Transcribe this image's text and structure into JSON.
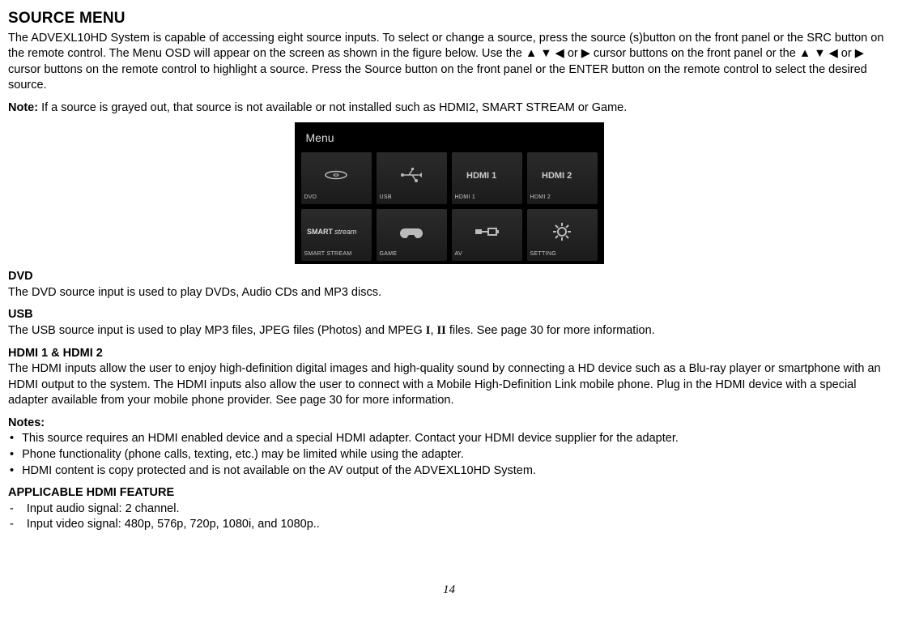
{
  "title": "SOURCE MENU",
  "intro_parts": {
    "a": "The ADVEXL10HD System is capable of accessing eight source inputs.  To select or change a source, press the source (s)button on the front panel or the SRC button on the remote control. The Menu OSD will appear on the screen as shown in the figure below.  Use the ",
    "b": " cursor buttons on the front panel or the ",
    "c": " cursor buttons on the remote control to highlight a source. Press the Source button on the front panel or the ENTER button on the remote control to select the desired source."
  },
  "arrows_seq": "▲ ▼ ◀ or ▶",
  "note_label": "Note:",
  "note_text": " If a source is grayed out, that source is not available or not installed such as HDMI2, SMART STREAM or Game.",
  "osd": {
    "menu_title": "Menu",
    "cells": [
      {
        "label": "DVD"
      },
      {
        "label": "USB"
      },
      {
        "label": "HDMI 1"
      },
      {
        "label": "HDMI 2"
      },
      {
        "label": "SMART STREAM"
      },
      {
        "label": "GAME"
      },
      {
        "label": "AV"
      },
      {
        "label": "SETTING"
      }
    ]
  },
  "sections": {
    "dvd": {
      "heading": "DVD",
      "body": "The DVD source input is used to play DVDs, Audio CDs and MP3 discs."
    },
    "usb": {
      "heading": "USB",
      "body_a": "The USB source input is used to play MP3 files, JPEG files (Photos) and MPEG ",
      "one": "I",
      "comma": ", ",
      "two": "II",
      "body_b": " files. See page 30 for more information."
    },
    "hdmi": {
      "heading": "HDMI 1 & HDMI 2",
      "body": "The HDMI inputs allow the user to enjoy high-definition digital images and high-quality sound by connecting a HD device such as a Blu-ray player or smartphone with an HDMI output to the system. The HDMI inputs also allow the user to connect with a Mobile High-Definition Link mobile phone. Plug in the HDMI device with a special adapter available from your mobile phone provider. See page 30 for more information."
    },
    "notes_heading": "Notes:",
    "notes": [
      "This source requires an HDMI enabled device and a special HDMI adapter. Contact your HDMI device supplier for the adapter.",
      "Phone functionality (phone calls, texting, etc.) may be limited while using the adapter.",
      "HDMI content is copy protected and is not available on the AV output of the ADVEXL10HD System."
    ],
    "feature_heading": "APPLICABLE HDMI FEATURE",
    "features": [
      "Input audio signal: 2 channel.",
      "Input video signal: 480p, 576p, 720p, 1080i, and 1080p.."
    ]
  },
  "page_number": "14"
}
